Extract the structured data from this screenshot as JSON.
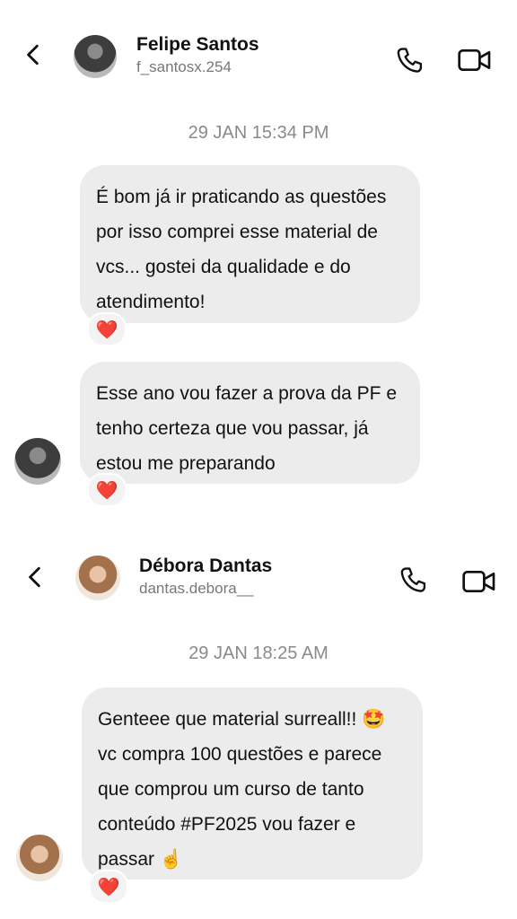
{
  "threads": [
    {
      "contact": {
        "name": "Felipe Santos",
        "handle": "f_santosx.254"
      },
      "timestamp": "29 JAN 15:34 PM",
      "messages": [
        {
          "text": "É bom já ir praticando as questões por isso comprei esse material de vcs... gostei da qualidade e do atendimento!",
          "reaction": "❤️"
        },
        {
          "text": "Esse ano vou fazer a prova da PF e tenho certeza que vou passar, já estou me preparando",
          "reaction": "❤️"
        }
      ]
    },
    {
      "contact": {
        "name": "Débora Dantas",
        "handle": "dantas.debora__"
      },
      "timestamp": "29 JAN 18:25 AM",
      "messages": [
        {
          "text": "Genteee que material surreall!! 🤩 vc compra 100 questões e parece que comprou um curso de tanto conteúdo #PF2025 vou fazer e passar ☝️",
          "reaction": "❤️"
        }
      ]
    }
  ],
  "icons": {
    "back": "chevron-left-icon",
    "call": "phone-icon",
    "video": "video-camera-icon",
    "reaction": "heart-icon"
  },
  "colors": {
    "bubble": "#ececec",
    "timestamp": "#8a8a8a",
    "handle": "#777777",
    "heart": "#e0212e"
  }
}
